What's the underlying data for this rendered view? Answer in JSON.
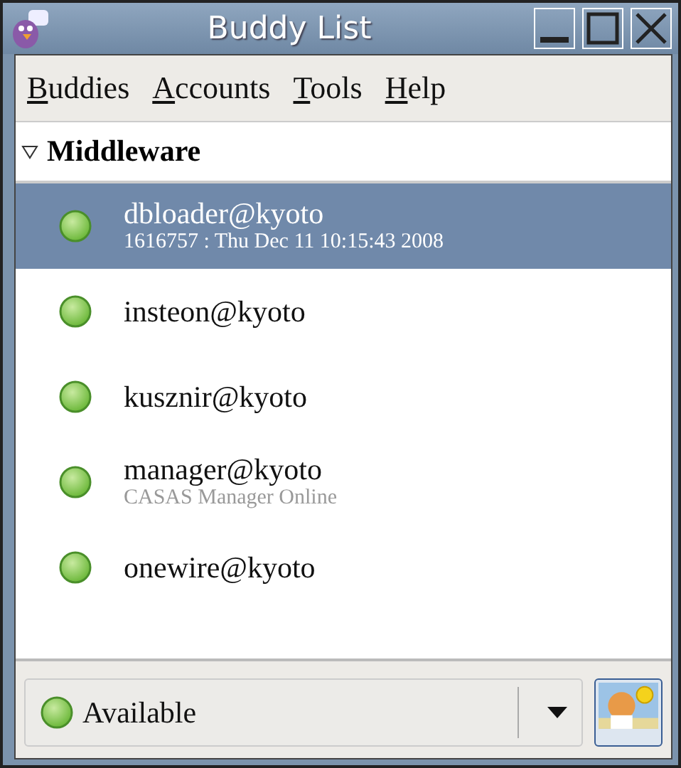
{
  "window": {
    "title": "Buddy List"
  },
  "menu": [
    "Buddies",
    "Accounts",
    "Tools",
    "Help"
  ],
  "group": {
    "name": "Middleware",
    "expanded": true,
    "buddies": [
      {
        "name": "dbloader@kyoto",
        "status": "1616757 : Thu Dec 11 10:15:43 2008",
        "selected": true
      },
      {
        "name": "insteon@kyoto",
        "selected": false
      },
      {
        "name": "kusznir@kyoto",
        "selected": false
      },
      {
        "name": "manager@kyoto",
        "status": "CASAS Manager Online",
        "selected": false
      },
      {
        "name": "onewire@kyoto",
        "selected": false
      }
    ]
  },
  "status_selector": {
    "value": "Available"
  }
}
